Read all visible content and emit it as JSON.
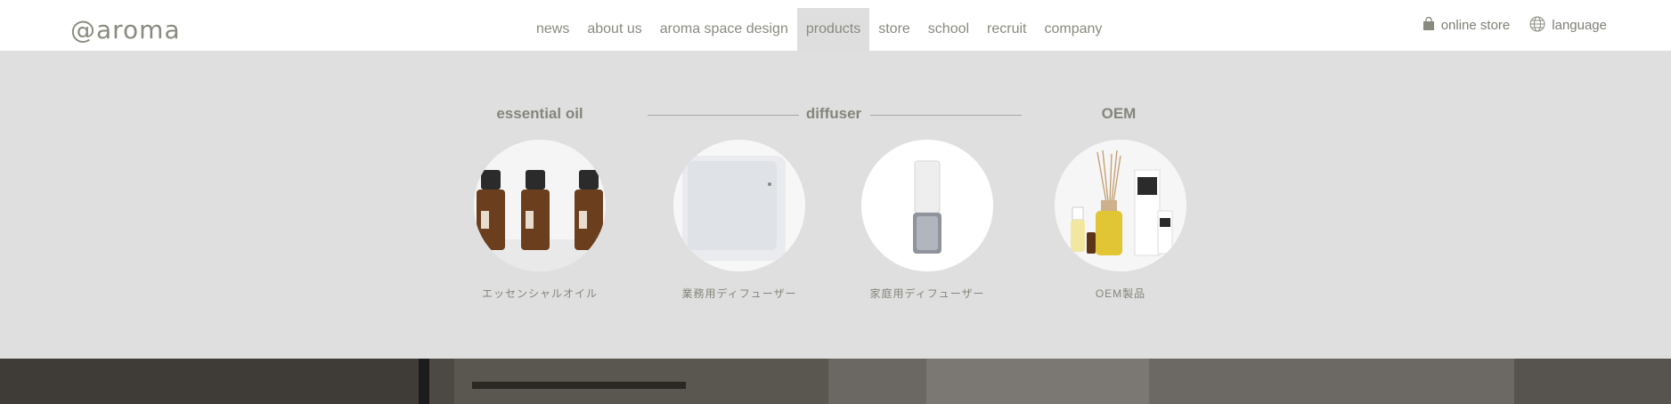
{
  "header": {
    "logo": "@aroma",
    "nav": [
      "news",
      "about us",
      "aroma space design",
      "products",
      "store",
      "school",
      "recruit",
      "company"
    ],
    "active_nav": "products",
    "utility": {
      "online_store": "online store",
      "language": "language"
    }
  },
  "mega": {
    "categories": {
      "essential_oil": "essential oil",
      "diffuser": "diffuser",
      "oem": "OEM"
    },
    "products": [
      {
        "label": "エッセンシャルオイル",
        "icon": "essential-oil-bottles"
      },
      {
        "label": "業務用ディフューザー",
        "icon": "commercial-diffuser"
      },
      {
        "label": "家庭用ディフューザー",
        "icon": "home-diffuser"
      },
      {
        "label": "OEM製品",
        "icon": "oem-products"
      }
    ]
  },
  "colors": {
    "text": "#8a8a80",
    "panel": "#dfdfdf",
    "active_tab": "#dedede"
  }
}
